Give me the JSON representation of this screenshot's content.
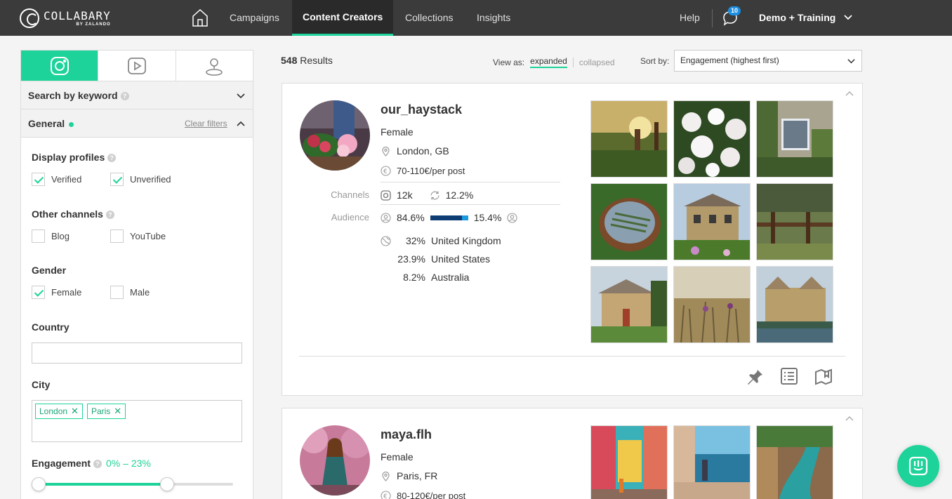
{
  "app": {
    "logo_text": "COLLABARY",
    "logo_sub": "BY ZALANDO"
  },
  "nav": {
    "items": [
      {
        "label": "Campaigns"
      },
      {
        "label": "Content Creators"
      },
      {
        "label": "Collections"
      },
      {
        "label": "Insights"
      }
    ],
    "active_index": 1,
    "help": "Help",
    "notification_count": "10",
    "account": "Demo + Training"
  },
  "sidebar": {
    "platform_tabs": [
      {
        "icon": "instagram-icon",
        "active": true
      },
      {
        "icon": "youtube-icon",
        "active": false
      },
      {
        "icon": "user-location-icon",
        "active": false
      }
    ],
    "keyword_section": "Search by keyword",
    "general_section": "General",
    "clear_filters": "Clear filters",
    "display_profiles": {
      "label": "Display profiles",
      "options": [
        {
          "label": "Verified",
          "checked": true
        },
        {
          "label": "Unverified",
          "checked": true
        }
      ]
    },
    "other_channels": {
      "label": "Other channels",
      "options": [
        {
          "label": "Blog",
          "checked": false
        },
        {
          "label": "YouTube",
          "checked": false
        }
      ]
    },
    "gender": {
      "label": "Gender",
      "options": [
        {
          "label": "Female",
          "checked": true
        },
        {
          "label": "Male",
          "checked": false
        }
      ]
    },
    "country": {
      "label": "Country",
      "value": ""
    },
    "city": {
      "label": "City",
      "tags": [
        "London",
        "Paris"
      ]
    },
    "engagement": {
      "label": "Engagement",
      "range": "0% – 23%",
      "low": 0,
      "high": 0.66
    }
  },
  "results": {
    "count": "548",
    "count_label": "Results",
    "view_as_label": "View as:",
    "view_expanded": "expanded",
    "view_collapsed": "collapsed",
    "sort_label": "Sort by:",
    "sort_value": "Engagement (highest first)"
  },
  "creators": [
    {
      "username": "our_haystack",
      "gender": "Female",
      "location": "London, GB",
      "price": "70-110€/per post",
      "channels_label": "Channels",
      "followers": "12k",
      "engagement": "12.2%",
      "audience_label": "Audience",
      "audience_female": "84.6%",
      "audience_male": "15.4%",
      "audience_female_fraction": 0.846,
      "countries": [
        {
          "pct": "32%",
          "name": "United Kingdom"
        },
        {
          "pct": "23.9%",
          "name": "United States"
        },
        {
          "pct": "8.2%",
          "name": "Australia"
        }
      ]
    },
    {
      "username": "maya.flh",
      "gender": "Female",
      "location": "Paris, FR",
      "price": "80-120€/per post"
    }
  ],
  "colors": {
    "accent": "#1ed39a",
    "topbar": "#3b3b3b",
    "badge": "#1c8ee0",
    "audience_female_bar": "#0d3d73",
    "audience_male_bar": "#1c9ae0"
  }
}
